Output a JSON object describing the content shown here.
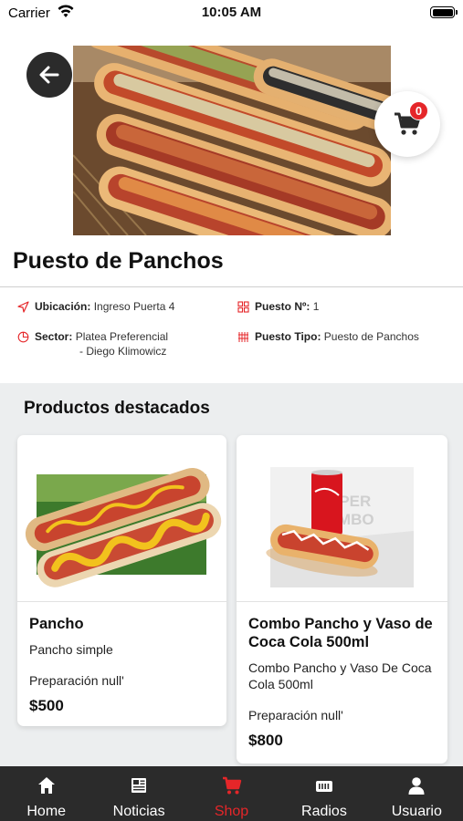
{
  "status_bar": {
    "carrier": "Carrier",
    "time": "10:05 AM"
  },
  "header": {
    "title": "Puesto de Panchos",
    "cart_count": "0"
  },
  "info": {
    "ubicacion_label": "Ubicación:",
    "ubicacion_value": "Ingreso Puerta 4",
    "puesto_label": "Puesto Nº:",
    "puesto_value": "1",
    "sector_label": "Sector:",
    "sector_value_1": "Platea Preferencial",
    "sector_value_2": "- Diego Klimowicz",
    "tipo_label": "Puesto Tipo:",
    "tipo_value": "Puesto de Panchos"
  },
  "featured": {
    "title": "Productos destacados",
    "products": [
      {
        "name": "Pancho",
        "description": "Pancho simple",
        "prep": "Preparación null'",
        "price": "$500"
      },
      {
        "name": "Combo Pancho y Vaso de Coca Cola 500ml",
        "description": "Combo Pancho y Vaso De Coca Cola 500ml",
        "prep": "Preparación null'",
        "price": "$800",
        "image_text_1": "SUPER",
        "image_text_2": "COMBO"
      }
    ]
  },
  "tabs": [
    {
      "label": "Home",
      "icon": "home-icon"
    },
    {
      "label": "Noticias",
      "icon": "newspaper-icon"
    },
    {
      "label": "Shop",
      "icon": "cart-icon",
      "active": true
    },
    {
      "label": "Radios",
      "icon": "radio-icon"
    },
    {
      "label": "Usuario",
      "icon": "user-icon"
    }
  ],
  "colors": {
    "accent": "#e52629",
    "tabbar": "#2b2b2b",
    "featured_bg": "#eceeef"
  }
}
